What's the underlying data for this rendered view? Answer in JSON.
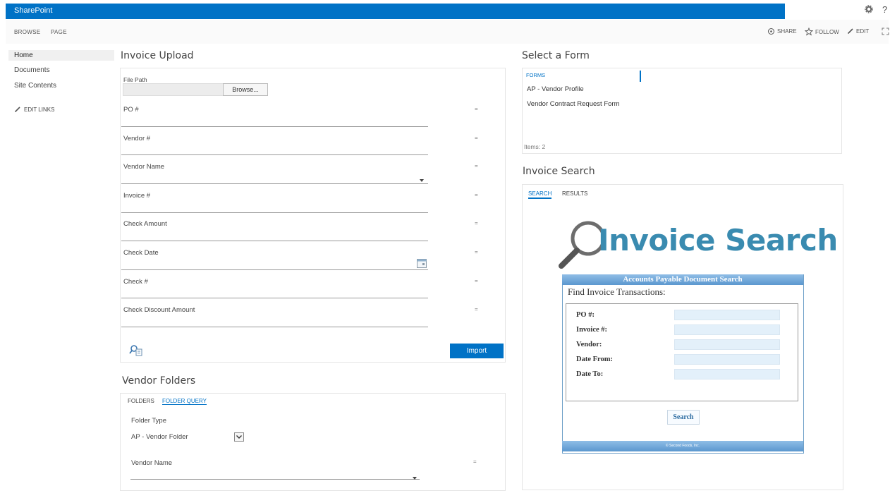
{
  "suitebar": {
    "brand": "SharePoint"
  },
  "topbar": {
    "settings_icon": "gear-icon",
    "help": "?"
  },
  "ribbon": {
    "tabs": [
      "BROWSE",
      "PAGE"
    ],
    "actions": {
      "share": "SHARE",
      "follow": "FOLLOW",
      "edit": "EDIT"
    }
  },
  "nav": {
    "items": [
      "Home",
      "Documents",
      "Site Contents"
    ],
    "edit_links": "EDIT LINKS"
  },
  "invoice_upload": {
    "title": "Invoice Upload",
    "file_path_label": "File Path",
    "browse_label": "Browse...",
    "fields": [
      "PO #",
      "Vendor #",
      "Vendor Name",
      "Invoice #",
      "Check Amount",
      "Check Date",
      "Check #",
      "Check Discount Amount"
    ],
    "marker": "=",
    "import_label": "Import"
  },
  "select_form": {
    "title": "Select a Form",
    "header": "FORMS",
    "forms": [
      "AP - Vendor Profile",
      "Vendor Contract Request Form"
    ],
    "count": "Items: 2"
  },
  "invoice_search": {
    "title": "Invoice Search",
    "tabs": [
      "SEARCH",
      "RESULTS"
    ],
    "logo_text": "Invoice Search",
    "ap_header": "Accounts Payable Document Search",
    "ap_subtitle": "Find Invoice Transactions:",
    "ap_fields": [
      "PO #:",
      "Invoice #:",
      "Vendor:",
      "Date From:",
      "Date To:"
    ],
    "search_label": "Search",
    "footer": "© Second Foods, Inc."
  },
  "vendor_folders": {
    "title": "Vendor Folders",
    "tabs": [
      "FOLDERS",
      "FOLDER QUERY"
    ],
    "folder_type_label": "Folder Type",
    "folder_type_value": "AP - Vendor Folder",
    "vendor_name_label": "Vendor Name",
    "marker": "="
  },
  "colors": {
    "brand_blue": "#0072c6",
    "link_blue": "#0072c6",
    "logo_blue": "#3a8bb0"
  }
}
